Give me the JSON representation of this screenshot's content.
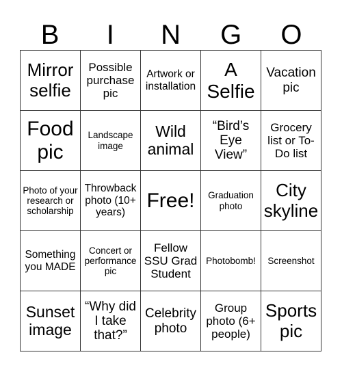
{
  "header": {
    "letters": [
      "B",
      "I",
      "N",
      "G",
      "O"
    ]
  },
  "card": {
    "cells": [
      [
        "Mirror selfie",
        "Possible purchase pic",
        "Artwork or installation",
        "A Selfie",
        "Vacation pic"
      ],
      [
        "Food pic",
        "Landscape image",
        "Wild animal",
        "“Bird’s Eye View”",
        "Grocery list or To-Do list"
      ],
      [
        "Photo of your research or scholarship",
        "Throwback photo (10+ years)",
        "Free!",
        "Graduation photo",
        "City skyline"
      ],
      [
        "Something you MADE",
        "Concert or performance pic",
        "Fellow SSU Grad Student",
        "Photobomb!",
        "Screenshot"
      ],
      [
        "Sunset image",
        "“Why did I take that?”",
        "Celebrity photo",
        "Group photo (6+ people)",
        "Sports pic"
      ]
    ]
  }
}
